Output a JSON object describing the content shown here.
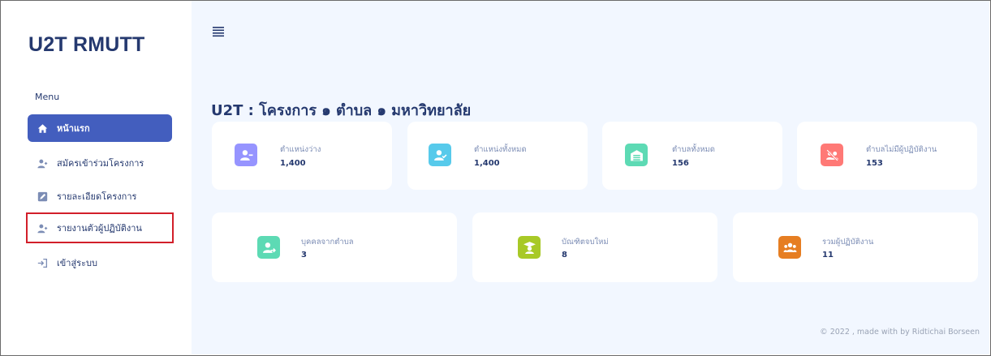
{
  "sidebar": {
    "brand": "U2T RMUTT",
    "menu_title": "Menu",
    "items": [
      {
        "label": "หน้าแรก",
        "icon": "home-icon",
        "active": true
      },
      {
        "label": "สมัครเข้าร่วมโครงการ",
        "icon": "user-plus-icon",
        "active": false
      },
      {
        "label": "รายละเอียดโครงการ",
        "icon": "edit-icon",
        "active": false
      },
      {
        "label": "รายงานตัวผู้ปฏิบัติงาน",
        "icon": "user-plus-icon",
        "active": false
      },
      {
        "label": "เข้าสู่ระบบ",
        "icon": "login-icon",
        "active": false
      }
    ]
  },
  "header": {
    "menu_toggle": "hamburger-icon"
  },
  "main": {
    "title": "U2T : โครงการ ๑ ตำบล ๑ มหาวิทยาลัย",
    "stats_row1": [
      {
        "label": "ตำแหน่งว่าง",
        "value": "1,400",
        "icon": "user-minus-icon",
        "color": "#9694ff"
      },
      {
        "label": "ตำแหน่งทั้งหมด",
        "value": "1,400",
        "icon": "user-check-icon",
        "color": "#57caeb"
      },
      {
        "label": "ตำบลทั้งหมด",
        "value": "156",
        "icon": "warehouse-icon",
        "color": "#5ddab4"
      },
      {
        "label": "ตำบลไม่มีผู้ปฏิบัติงาน",
        "value": "153",
        "icon": "users-slash-icon",
        "color": "#ff7976"
      }
    ],
    "stats_row2": [
      {
        "label": "บุคคลจากตำบล",
        "value": "3",
        "icon": "user-arrow-icon",
        "color": "#5ddab4"
      },
      {
        "label": "บัณฑิตจบใหม่",
        "value": "8",
        "icon": "graduate-icon",
        "color": "#a8c927"
      },
      {
        "label": "รวมผู้ปฏิบัติงาน",
        "value": "11",
        "icon": "users-icon",
        "color": "#e67e22"
      }
    ]
  },
  "footer": {
    "text": "© 2022 , made with by Ridtichai Borseen"
  }
}
